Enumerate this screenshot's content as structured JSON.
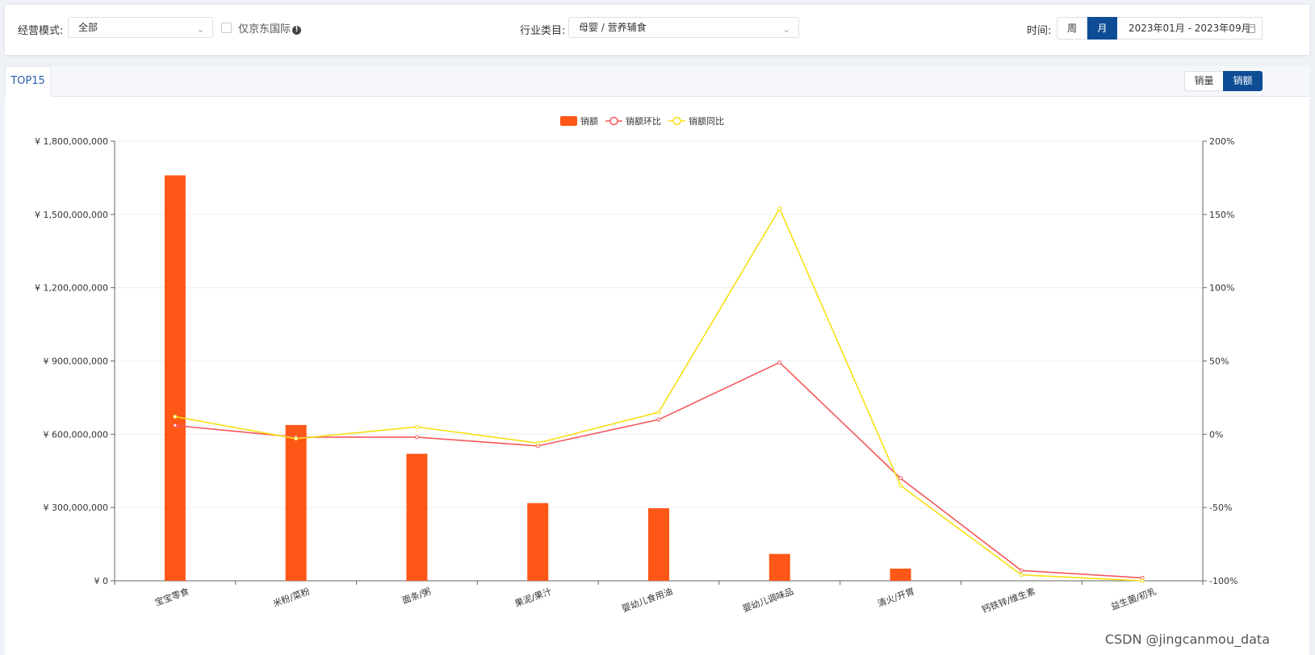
{
  "filters": {
    "mode_label": "经营模式:",
    "mode_value": "全部",
    "jd_intl_label": "仅京东国际",
    "industry_label": "行业类目:",
    "industry_value": "母婴 / 营养辅食",
    "time_label": "时间:",
    "week_label": "周",
    "month_label": "月",
    "date_range": "2023年01月 - 2023年09月"
  },
  "tabs": {
    "active": "TOP15"
  },
  "toggle": {
    "volume": "销量",
    "amount": "销额"
  },
  "colors": {
    "bar": "#ff5717",
    "mom": "#f4585e",
    "yoy": "#f7df10",
    "accent": "#0e4d96"
  },
  "chart_data": {
    "type": "bar",
    "categories": [
      "宝宝零食",
      "米粉/菜粉",
      "面条/粥",
      "果泥/果汁",
      "婴幼儿食用油",
      "婴幼儿调味品",
      "清火/开胃",
      "钙铁锌/维生素",
      "益生菌/初乳"
    ],
    "series": [
      {
        "name": "销额",
        "type": "bar",
        "axis": "left",
        "values": [
          1660000000,
          638000000,
          520000000,
          318000000,
          297000000,
          110000000,
          50000000,
          0,
          0
        ]
      },
      {
        "name": "销额环比",
        "type": "line",
        "axis": "right",
        "values": [
          6,
          -2,
          -2,
          -8,
          10,
          49,
          -30,
          -93,
          -98
        ]
      },
      {
        "name": "销额同比",
        "type": "line",
        "axis": "right",
        "values": [
          12,
          -3,
          5,
          -6,
          15,
          154,
          -35,
          -96,
          -100
        ]
      }
    ],
    "left_axis": {
      "min": 0,
      "max": 1800000000,
      "ticks": [
        "¥ 0",
        "¥ 300,000,000",
        "¥ 600,000,000",
        "¥ 900,000,000",
        "¥ 1,200,000,000",
        "¥ 1,500,000,000",
        "¥ 1,800,000,000"
      ]
    },
    "right_axis": {
      "min": -100,
      "max": 200,
      "ticks": [
        "-100%",
        "-50%",
        "0%",
        "50%",
        "100%",
        "150%",
        "200%"
      ]
    },
    "legend_position": "top-center",
    "grid": true
  },
  "watermark": "CSDN @jingcanmou_data"
}
